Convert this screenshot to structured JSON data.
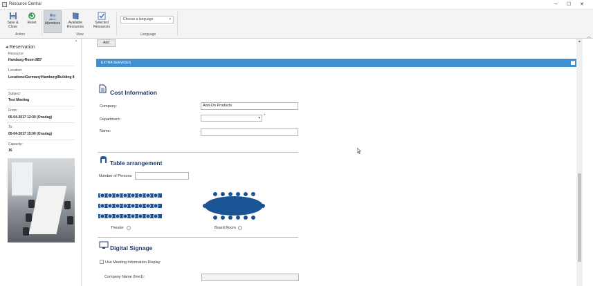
{
  "window": {
    "title": "Resource Central",
    "minimize": "─",
    "maximize": "☐",
    "close": "✕"
  },
  "ribbon": {
    "buttons": {
      "save_close": "Save & Close",
      "reset": "Reset",
      "attendees": "Attendees",
      "available_resources": "Available Resources",
      "selected_resources": "Selected Resources"
    },
    "groups": {
      "action": "Action",
      "view": "View",
      "language": "Language"
    },
    "language_select": {
      "value": "Choose a language"
    }
  },
  "sidebar": {
    "title": "Reservation",
    "fields": [
      {
        "label": "Resource:",
        "value": "Hamburg-Room 8B7"
      },
      {
        "label": "Location:",
        "value": "Locations\\Germany\\Hamburg\\Building 8"
      },
      {
        "label": "Subject:",
        "value": "Test Meeting"
      },
      {
        "label": "From:",
        "value": "05-04-2017 12:30 (Onsdag)"
      },
      {
        "label": "To:",
        "value": "05-04-2017 15:00 (Onsdag)"
      },
      {
        "label": "Capacity:",
        "value": "16"
      }
    ]
  },
  "main": {
    "add_button": "Add",
    "extra_services": "EXTRA SERVICES",
    "extra_toggle": "−",
    "cost": {
      "heading": "Cost Information",
      "company_label": "Company:",
      "company_value": "Add-On Products",
      "department_label": "Department:",
      "department_required": "*",
      "name_label": "Name:",
      "name_value": ""
    },
    "table": {
      "heading": "Table arrangement",
      "persons_label": "Number of Persons",
      "persons_value": "",
      "options": [
        {
          "label": "Theater"
        },
        {
          "label": "Board Room"
        }
      ]
    },
    "signage": {
      "heading": "Digital Signage",
      "checkbox_label": "Use Meeting Information Display",
      "company_line1_label": "Company Name (line1):",
      "company_line1_value": ""
    }
  },
  "colors": {
    "accent": "#3f8fd2",
    "heading": "#1f3a66",
    "layout_blue": "#1b5494"
  }
}
